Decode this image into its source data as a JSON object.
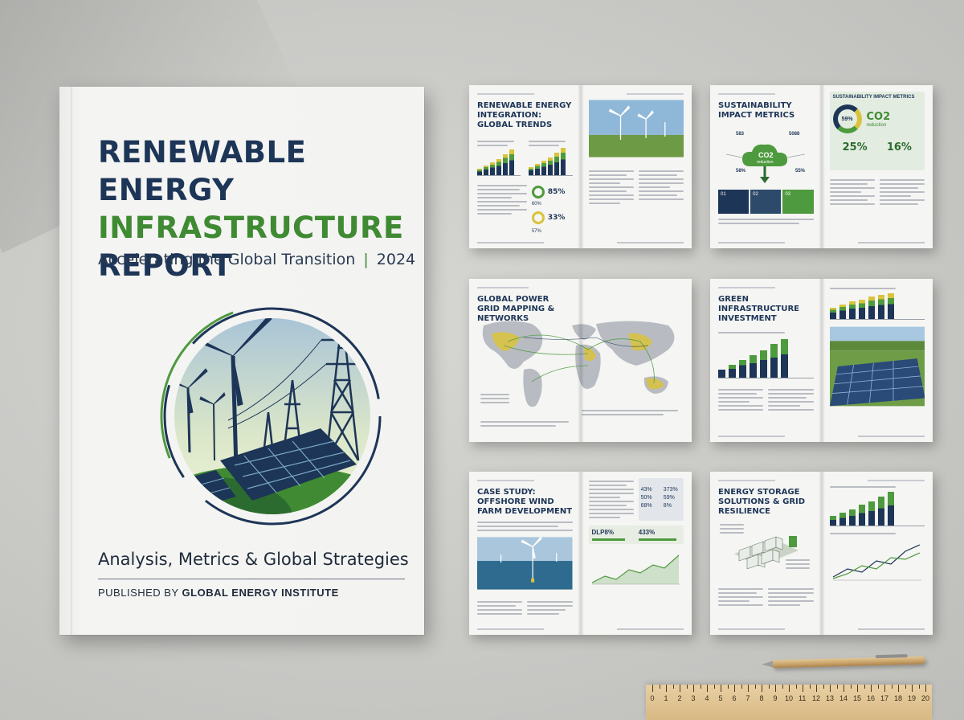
{
  "cover": {
    "title_line1": "RENEWABLE ENERGY",
    "title_line2": "INFRASTRUCTURE",
    "title_line3": "REPORT",
    "subtitle_main": "Accelerating the Global Transition",
    "subtitle_sep": "|",
    "subtitle_year": "2024",
    "footer_tagline": "Analysis, Metrics & Global Strategies",
    "publisher_prefix": "PUBLISHED BY",
    "publisher_name": "GLOBAL ENERGY INSTITUTE"
  },
  "spreads": {
    "s1": {
      "title": "RENEWABLE ENERGY INTEGRATION: GLOBAL TRENDS",
      "stat1": "85%",
      "stat2": "60%",
      "stat3": "33%",
      "stat4": "57%"
    },
    "s2": {
      "title": "SUSTAINABILITY IMPACT METRICS",
      "right_title": "SUSTAINABILITY IMPACT METRICS",
      "co2": "CO2",
      "co2_label": "reduction",
      "ring_pct": "59%",
      "big1": "25%",
      "big2": "16%",
      "step1": "01",
      "step2": "02",
      "step3": "03",
      "num1": "583",
      "num2": "5088",
      "num3": "58%",
      "num4": "55%"
    },
    "s3": {
      "title": "GLOBAL POWER GRID MAPPING & NETWORKS"
    },
    "s4": {
      "title": "GREEN INFRASTRUCTURE INVESTMENT"
    },
    "s5": {
      "title": "CASE STUDY: OFFSHORE WIND FARM DEVELOPMENT",
      "stats": [
        "43%",
        "373%",
        "50%",
        "59%",
        "68%",
        "8%"
      ],
      "big": "DLP8%",
      "big2": "433%"
    },
    "s6": {
      "title": "ENERGY STORAGE SOLUTIONS & GRID RESILIENCE"
    }
  },
  "ruler": {
    "numbers": [
      "0",
      "1",
      "2",
      "3",
      "4",
      "5",
      "6",
      "7",
      "8",
      "9",
      "10",
      "11",
      "12",
      "13",
      "14",
      "15",
      "16",
      "17",
      "18",
      "19",
      "20"
    ]
  },
  "colors": {
    "navy": "#1d3557",
    "green": "#3f8a32",
    "yellow": "#d9c33b",
    "paper": "#f4f4f3",
    "background": "#c9c9c6"
  }
}
